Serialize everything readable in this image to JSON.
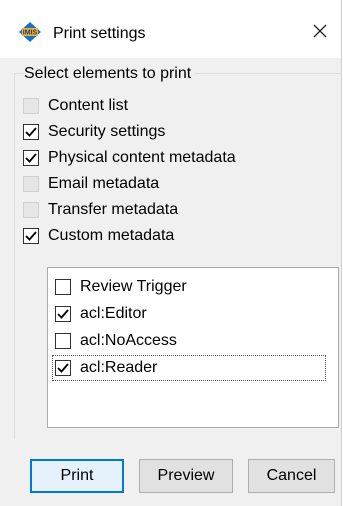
{
  "window": {
    "title": "Print settings",
    "icon": "imis-app-icon",
    "close_icon": "close-icon"
  },
  "group": {
    "legend": "Select elements to print",
    "items": [
      {
        "label": "Content list",
        "checked": false,
        "enabled": false
      },
      {
        "label": "Security settings",
        "checked": true,
        "enabled": true
      },
      {
        "label": "Physical content metadata",
        "checked": true,
        "enabled": true
      },
      {
        "label": "Email metadata",
        "checked": false,
        "enabled": false
      },
      {
        "label": "Transfer metadata",
        "checked": false,
        "enabled": false
      },
      {
        "label": "Custom metadata",
        "checked": true,
        "enabled": true
      }
    ]
  },
  "custom_list": {
    "items": [
      {
        "label": "Review Trigger",
        "checked": false
      },
      {
        "label": "acl:Editor",
        "checked": true
      },
      {
        "label": "acl:NoAccess",
        "checked": false
      },
      {
        "label": "acl:Reader",
        "checked": true,
        "focused": true
      }
    ]
  },
  "buttons": {
    "print": "Print",
    "preview": "Preview",
    "cancel": "Cancel"
  },
  "colors": {
    "dialog_bg": "#f0f0f0",
    "accent": "#0078d7",
    "checkbox_disabled": "#e6e6e6"
  }
}
